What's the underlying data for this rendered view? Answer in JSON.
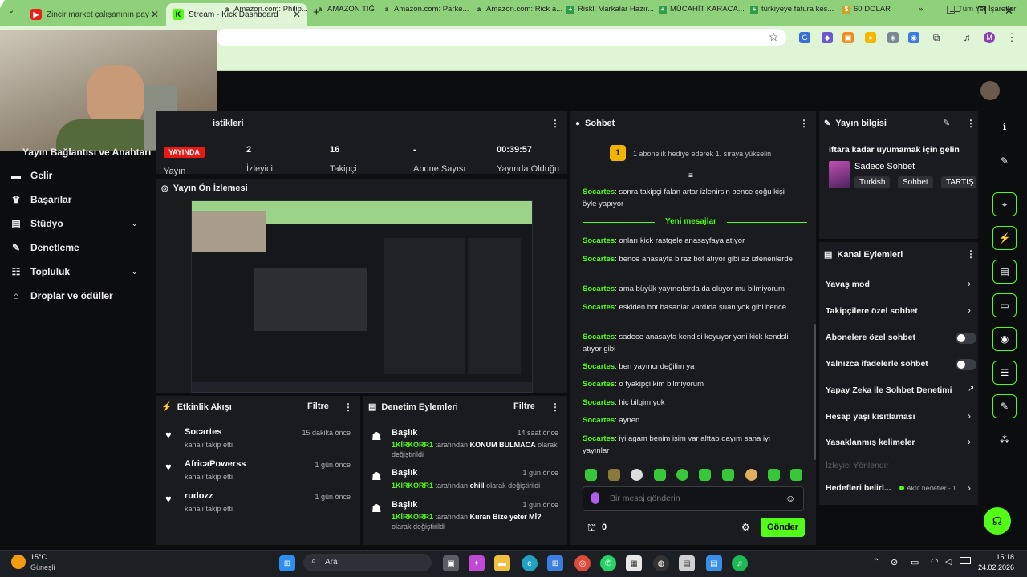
{
  "browser": {
    "tabs": [
      {
        "title": "Zincir market çalışanının paylaş",
        "active": false
      },
      {
        "title": "Stream - Kick Dashboard",
        "active": true
      }
    ],
    "new_tab": "+",
    "window_controls": {
      "minimize": "—",
      "maximize": "❐",
      "close": "✕"
    },
    "bookmarks": [
      "Amazon.com: Philip...",
      "AMAZON TIĞ",
      "Amazon.com: Parke...",
      "Amazon.com: Rick a...",
      "Riskli Markalar Hazır...",
      "MÜCAHİT KARACA...",
      "türkiyeye fatura kes...",
      "60 DOLAR"
    ],
    "bookmarks_more": "»",
    "all_bookmarks": "Tüm Yer İşaretleri",
    "profile_initial": "M"
  },
  "sidebar": {
    "header_partial": "Yayın Bağlantısı ve Anahtarı",
    "items": [
      {
        "label": "Gelir",
        "icon": "revenue-icon"
      },
      {
        "label": "Başarılar",
        "icon": "trophy-icon"
      },
      {
        "label": "Stüdyo",
        "icon": "studio-icon",
        "expandable": true
      },
      {
        "label": "Denetleme",
        "icon": "wrench-icon"
      },
      {
        "label": "Topluluk",
        "icon": "community-icon",
        "expandable": true
      },
      {
        "label": "Droplar ve ödüller",
        "icon": "gift-icon"
      }
    ]
  },
  "stats": {
    "title_partial": "istikleri",
    "live_badge": "YAYINDA",
    "items": [
      {
        "label": "Yayın",
        "value": ""
      },
      {
        "label": "İzleyici",
        "value": "2"
      },
      {
        "label": "Takipçi",
        "value": "16"
      },
      {
        "label": "Abone Sayısı",
        "value": "-"
      },
      {
        "label": "Yayında Olduğu",
        "value": "00:39:57"
      }
    ]
  },
  "preview": {
    "title": "Yayın Ön İzlemesi"
  },
  "activity": {
    "title": "Etkinlik Akışı",
    "filter": "Filtre",
    "events": [
      {
        "name": "Socartes",
        "action": "kanalı takip etti",
        "time": "15 dakika önce"
      },
      {
        "name": "AfricaPowerss",
        "action": "kanalı takip etti",
        "time": "1 gün önce"
      },
      {
        "name": "rudozz",
        "action": "kanalı takip etti",
        "time": "1 gün önce"
      }
    ]
  },
  "moderation": {
    "title": "Denetim Eylemleri",
    "filter": "Filtre",
    "actions": [
      {
        "heading": "Başlık",
        "time": "14 saat önce",
        "user": "1KİRKORR1",
        "middle": "tarafından",
        "value": "KONUM BULMACA",
        "tail": "olarak değiştirildi"
      },
      {
        "heading": "Başlık",
        "time": "1 gün önce",
        "user": "1KİRKORR1",
        "middle": "tarafından",
        "value": "chill",
        "tail": "olarak değiştirildi"
      },
      {
        "heading": "Başlık",
        "time": "1 gün önce",
        "user": "1KİRKORR1",
        "middle": "tarafından",
        "value": "Kuran Bize yeter Mİ?",
        "tail": "olarak değiştirildi"
      }
    ]
  },
  "chat": {
    "title": "Sohbet",
    "gift_badge": "1",
    "gift_text": "1 abonelik hediye ederek 1. sıraya yükselin",
    "new_messages": "Yeni mesajlar",
    "messages": [
      {
        "user": "Socartes",
        "text": "sonra takipçi falan artar izlenirsin bence çoğu kişi öyle yapıyor"
      },
      {
        "user": "Socartes",
        "text": "onları kick rastgele anasayfaya atıyor"
      },
      {
        "user": "Socartes",
        "text": "bence anasayfa biraz bot atıyor gibi az izlenenlerde"
      },
      {
        "user": "Socartes",
        "text": "ama büyük yayıncılarda da oluyor mu bilmiyorum"
      },
      {
        "user": "Socartes",
        "text": "eskiden bot basanlar vardıda şuan yok gibi bence"
      },
      {
        "user": "Socartes",
        "text": "sadece anasayfa kendisi koyuyor yani kick kendsli atıyor gibi"
      },
      {
        "user": "Socartes",
        "text": "ben yayıncı değilim ya"
      },
      {
        "user": "Socartes",
        "text": "o tyakipçi kim bilmiyorum"
      },
      {
        "user": "Socartes",
        "text": "hiç bilgim yok"
      },
      {
        "user": "Socartes",
        "text": "aynen"
      },
      {
        "user": "Socartes",
        "text": "iyi agam benim işim var alttab dayım sana iyi yayınlar"
      }
    ],
    "input_placeholder": "Bir mesaj gönderin",
    "points": "0",
    "send": "Gönder"
  },
  "stream_info": {
    "title": "Yayın bilgisi",
    "stream_title": "iftara kadar uyumamak için gelin",
    "category": "Sadece Sohbet",
    "tags": [
      "Turkish",
      "Sohbet",
      "TARTIŞ"
    ]
  },
  "channel_actions": {
    "title": "Kanal Eylemleri",
    "items": [
      {
        "label": "Yavaş mod",
        "control": "arrow"
      },
      {
        "label": "Takipçilere özel sohbet",
        "control": "arrow"
      },
      {
        "label": "Abonelere özel sohbet",
        "control": "toggle",
        "on": false
      },
      {
        "label": "Yalnızca ifadelerle sohbet",
        "control": "toggle",
        "on": false
      },
      {
        "label": "Yapay Zeka ile Sohbet Denetimi",
        "control": "external"
      },
      {
        "label": "Hesap yaşı kısıtlaması",
        "control": "arrow"
      },
      {
        "label": "Yasaklanmış kelimeler",
        "control": "arrow"
      }
    ],
    "disabled_item": "İzleyici Yönlendir",
    "goals_label": "Hedefleri belirl...",
    "goals_status": "Aktif hedefler - 1"
  },
  "taskbar": {
    "weather_temp": "15°C",
    "weather_desc": "Güneşli",
    "search_placeholder": "Ara",
    "time": "15:18",
    "date": "24.02.2026"
  },
  "colors": {
    "accent": "#53fc18",
    "panel": "#191b1f",
    "background": "#0b0d0f",
    "live": "#e91916",
    "chrome": "#dff5d6"
  }
}
